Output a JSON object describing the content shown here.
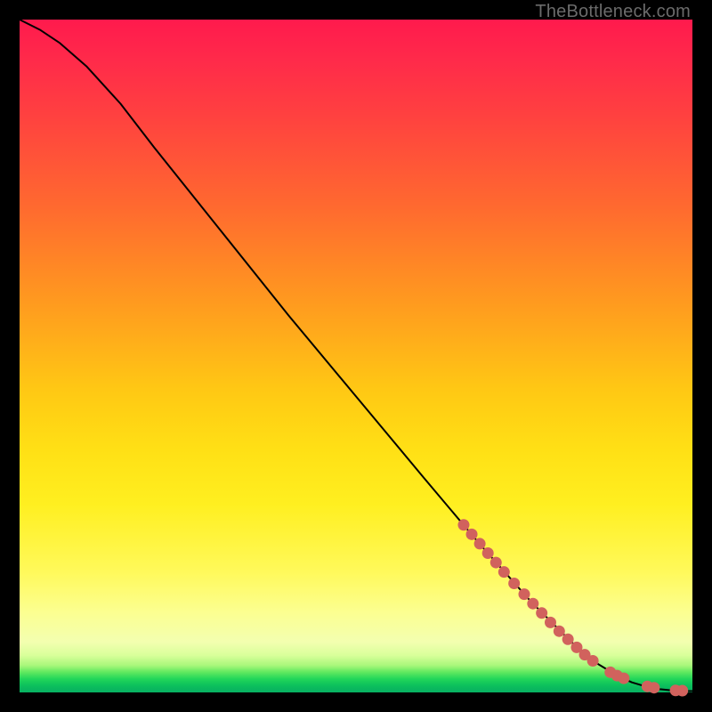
{
  "watermark": "TheBottleneck.com",
  "colors": {
    "dot": "#d1625d",
    "curve": "#000000"
  },
  "chart_data": {
    "type": "line",
    "title": "",
    "xlabel": "",
    "ylabel": "",
    "xlim": [
      0,
      100
    ],
    "ylim": [
      0,
      100
    ],
    "grid": false,
    "legend": false,
    "series": [
      {
        "name": "bottleneck-curve",
        "kind": "line",
        "x": [
          0,
          3,
          6,
          10,
          15,
          20,
          30,
          40,
          50,
          60,
          68,
          76,
          82,
          86,
          89,
          91,
          93,
          95,
          97,
          99,
          100
        ],
        "y": [
          100,
          98.5,
          96.5,
          93,
          87.5,
          81,
          68.5,
          56,
          44,
          32,
          22.5,
          13.5,
          7.5,
          4.2,
          2.4,
          1.5,
          0.9,
          0.5,
          0.3,
          0.2,
          0.2
        ]
      },
      {
        "name": "highlighted-points",
        "kind": "scatter",
        "x": [
          66.0,
          67.2,
          68.4,
          69.6,
          70.8,
          72.0,
          73.5,
          75.0,
          76.3,
          77.6,
          78.9,
          80.2,
          81.5,
          82.8,
          84.0,
          85.2,
          87.8,
          88.8,
          89.8,
          93.3,
          94.3,
          97.5,
          98.5
        ],
        "y": [
          24.9,
          23.5,
          22.1,
          20.7,
          19.3,
          17.9,
          16.2,
          14.6,
          13.2,
          11.8,
          10.4,
          9.1,
          7.9,
          6.7,
          5.6,
          4.7,
          3.0,
          2.5,
          2.1,
          0.9,
          0.7,
          0.3,
          0.26
        ]
      }
    ]
  }
}
